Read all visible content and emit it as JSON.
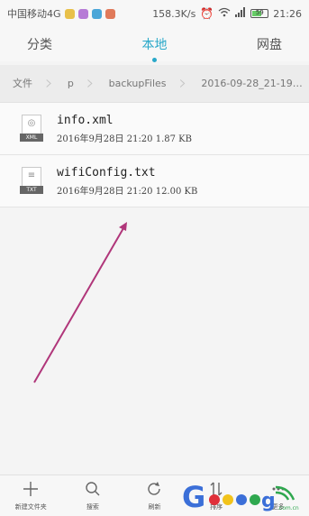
{
  "status": {
    "carrier": "中国移动4G",
    "speed": "158.3K/s",
    "battery": "59",
    "time": "21:26",
    "app_icon_colors": [
      "#e8c04a",
      "#b67bd6",
      "#4aa6d8",
      "#e07a5a"
    ]
  },
  "tabs": [
    {
      "label": "分类"
    },
    {
      "label": "本地"
    },
    {
      "label": "网盘"
    }
  ],
  "breadcrumb": [
    "文件",
    "p",
    "backupFiles",
    "2016-09-28_21-19…"
  ],
  "files": [
    {
      "name": "info.xml",
      "meta": "2016年9月28日 21:20 1.87 KB",
      "type": "XML",
      "icon": "xml-file-icon"
    },
    {
      "name": "wifiConfig.txt",
      "meta": "2016年9月28日 21:20 12.00 KB",
      "type": "TXT",
      "icon": "txt-file-icon"
    }
  ],
  "toolbar": [
    {
      "label": "新建文件夹",
      "icon": "plus-icon"
    },
    {
      "label": "搜索",
      "icon": "search-icon"
    },
    {
      "label": "刷新",
      "icon": "refresh-icon"
    },
    {
      "label": "排序",
      "icon": "sort-icon"
    },
    {
      "label": "更多",
      "icon": "more-icon"
    }
  ],
  "watermark": {
    "letter": "G",
    "domain": ".com.cn"
  },
  "colors": {
    "accent": "#29a8c9",
    "arrow": "#b0367a"
  }
}
